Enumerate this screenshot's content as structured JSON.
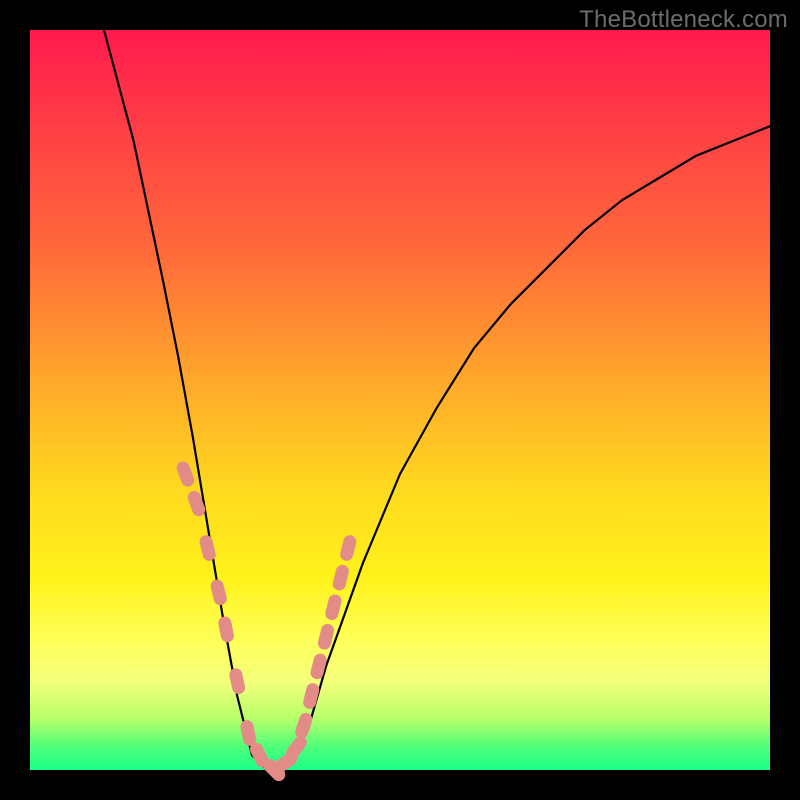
{
  "watermark": "TheBottleneck.com",
  "chart_data": {
    "type": "line",
    "title": "",
    "xlabel": "",
    "ylabel": "",
    "xlim": [
      0,
      100
    ],
    "ylim": [
      0,
      100
    ],
    "series": [
      {
        "name": "bottleneck-curve",
        "x": [
          10,
          14,
          18,
          20,
          22,
          24,
          26,
          28,
          30,
          32,
          34,
          36,
          38,
          40,
          45,
          50,
          55,
          60,
          65,
          70,
          75,
          80,
          85,
          90,
          95,
          100
        ],
        "y": [
          100,
          85,
          66,
          56,
          45,
          33,
          21,
          10,
          2,
          0,
          0,
          2,
          7,
          14,
          28,
          40,
          49,
          57,
          63,
          68,
          73,
          77,
          80,
          83,
          85,
          87
        ]
      }
    ],
    "markers": {
      "name": "highlighted-points",
      "color": "#e38b87",
      "x": [
        21,
        22.5,
        24,
        25.5,
        26.5,
        28,
        29.5,
        31,
        33,
        34.5,
        36,
        37,
        38,
        39,
        40,
        41,
        42,
        43
      ],
      "y": [
        40,
        36,
        30,
        24,
        19,
        12,
        5,
        2,
        0,
        1,
        3,
        6,
        10,
        14,
        18,
        22,
        26,
        30
      ]
    }
  }
}
